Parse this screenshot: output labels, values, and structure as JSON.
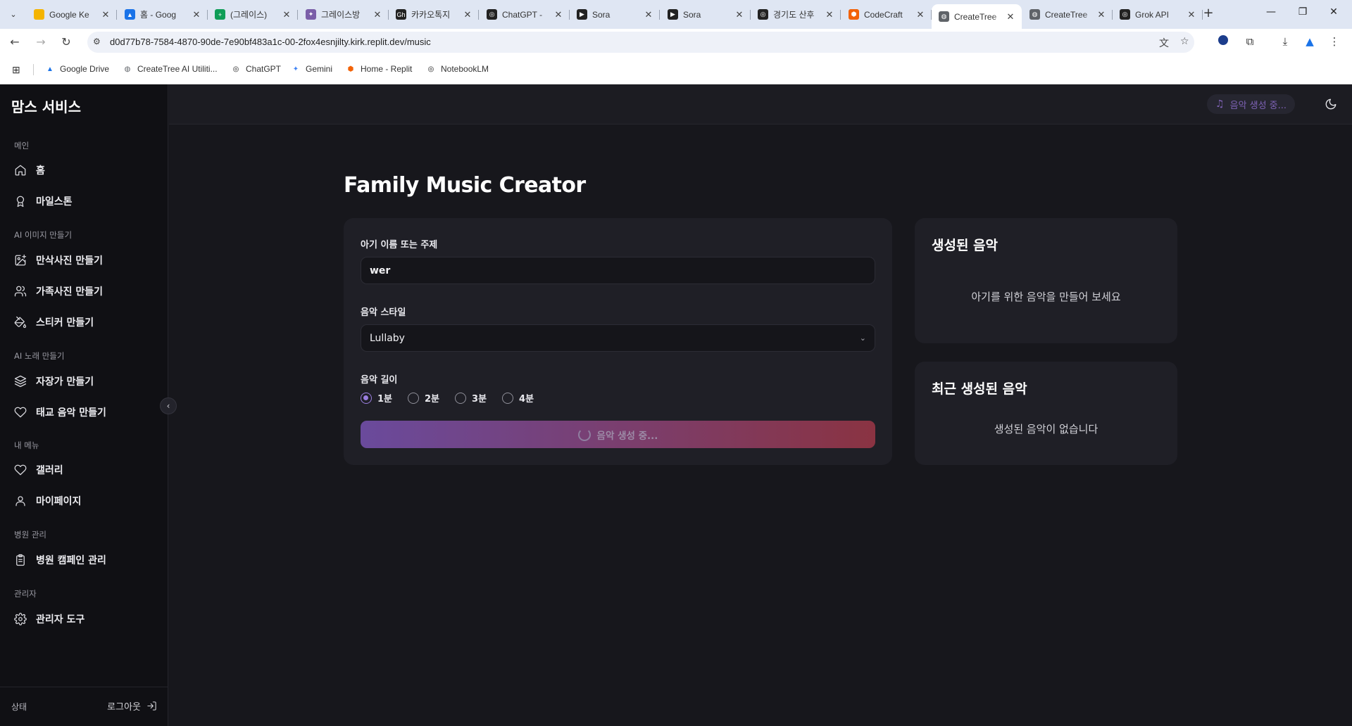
{
  "browser": {
    "tabs": [
      {
        "title": "Google Ke",
        "fav_color": "#f4b400",
        "fav_glyph": "",
        "active": false
      },
      {
        "title": "홈 - Goog",
        "fav_color": "#1a73e8",
        "fav_glyph": "▲",
        "active": false
      },
      {
        "title": "(그레이스)",
        "fav_color": "#0f9d58",
        "fav_glyph": "+",
        "active": false
      },
      {
        "title": "그레이스방",
        "fav_color": "#7a5ea8",
        "fav_glyph": "✦",
        "active": false
      },
      {
        "title": "카카오톡지",
        "fav_color": "#222222",
        "fav_glyph": "Gh",
        "active": false
      },
      {
        "title": "ChatGPT -",
        "fav_color": "#222222",
        "fav_glyph": "◎",
        "active": false
      },
      {
        "title": "Sora",
        "fav_color": "#222222",
        "fav_glyph": "▶",
        "active": false
      },
      {
        "title": "Sora",
        "fav_color": "#222222",
        "fav_glyph": "▶",
        "active": false
      },
      {
        "title": "경기도 산후",
        "fav_color": "#222222",
        "fav_glyph": "◎",
        "active": false
      },
      {
        "title": "CodeCraft",
        "fav_color": "#f26207",
        "fav_glyph": "⬢",
        "active": false
      },
      {
        "title": "CreateTree",
        "fav_color": "#5f6368",
        "fav_glyph": "◍",
        "active": true
      },
      {
        "title": "CreateTree",
        "fav_color": "#5f6368",
        "fav_glyph": "◍",
        "active": false
      },
      {
        "title": "Grok API",
        "fav_color": "#222222",
        "fav_glyph": "◎",
        "active": false
      }
    ],
    "url": "d0d77b78-7584-4870-90de-7e90bf483a1c-00-2fox4esnjilty.kirk.replit.dev/music",
    "bookmarks": [
      {
        "label": "Google Drive",
        "icon": "google-drive-icon",
        "color": "#1a73e8",
        "glyph": "▲"
      },
      {
        "label": "CreateTree AI Utiliti...",
        "icon": "globe-icon",
        "color": "#5f6368",
        "glyph": "◍"
      },
      {
        "label": "ChatGPT",
        "icon": "openai-icon",
        "color": "#222222",
        "glyph": "◎"
      },
      {
        "label": "Gemini",
        "icon": "gemini-icon",
        "color": "#4285f4",
        "glyph": "✦"
      },
      {
        "label": "Home - Replit",
        "icon": "replit-icon",
        "color": "#f26207",
        "glyph": "⬢"
      },
      {
        "label": "NotebookLM",
        "icon": "notebooklm-icon",
        "color": "#222222",
        "glyph": "◎"
      }
    ]
  },
  "sidebar": {
    "brand": "맘스 서비스",
    "sections": {
      "main": "메인",
      "ai_image": "AI 이미지 만들기",
      "ai_song": "AI 노래 만들기",
      "my_menu": "내 메뉴",
      "hospital": "병원 관리",
      "admin": "관리자"
    },
    "items": {
      "home": "홈",
      "milestone": "마일스톤",
      "maternity_photo": "만삭사진 만들기",
      "family_photo": "가족사진 만들기",
      "sticker": "스티커 만들기",
      "lullaby": "자장가 만들기",
      "prenatal_music": "태교 음악 만들기",
      "gallery": "갤러리",
      "mypage": "마이페이지",
      "hospital_campaign": "병원 캠페인 관리",
      "admin_tools": "관리자 도구"
    },
    "status_label": "상태",
    "logout_label": "로그아웃"
  },
  "header": {
    "generating_pill": "음악 생성 중..."
  },
  "main": {
    "title": "Family Music Creator",
    "form": {
      "name_label": "아기 이름 또는 주제",
      "name_value": "wer",
      "style_label": "음악 스타일",
      "style_value": "Lullaby",
      "length_label": "음악 길이",
      "length_options": [
        "1분",
        "2분",
        "3분",
        "4분"
      ],
      "length_selected": "1분",
      "submit_label": "음악 생성 중..."
    },
    "generated": {
      "title": "생성된 음악",
      "empty": "아기를 위한 음악을 만들어 보세요"
    },
    "recent": {
      "title": "최근 생성된 음악",
      "empty": "생성된 음악이 없습니다"
    }
  },
  "colors": {
    "accent_purple": "#7e62b5",
    "button_gradient_start": "#6a4a9c",
    "button_gradient_end": "#8a3342"
  }
}
